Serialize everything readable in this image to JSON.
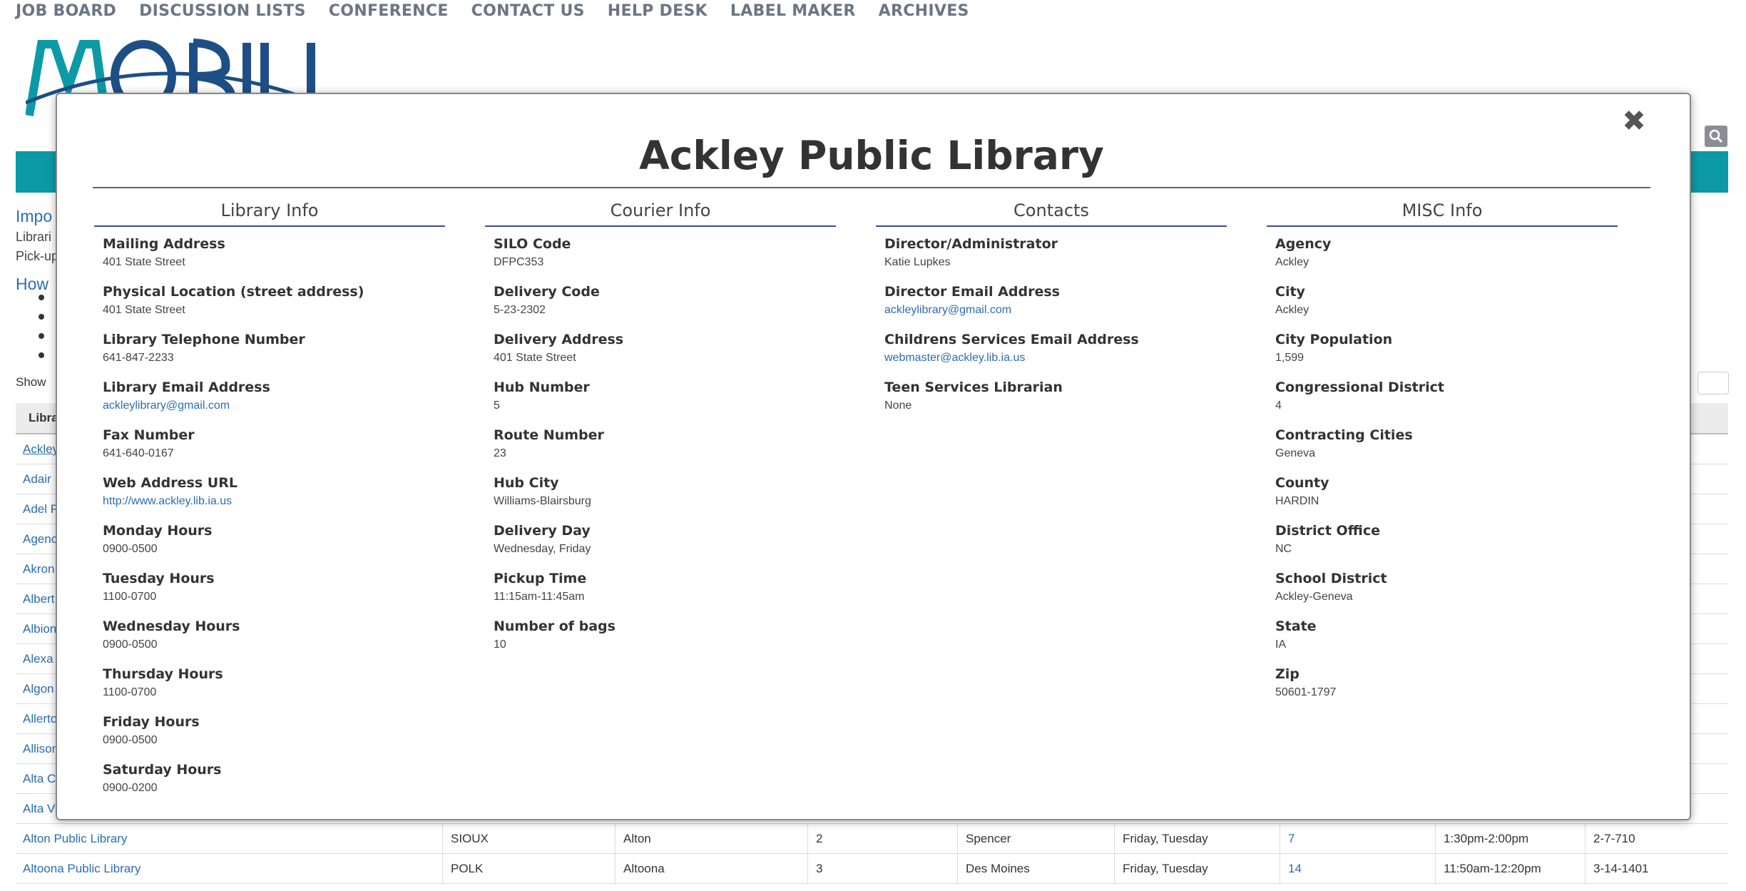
{
  "topnav": [
    "JOB BOARD",
    "DISCUSSION LISTS",
    "CONFERENCE",
    "CONTACT US",
    "HELP DESK",
    "LABEL MAKER",
    "ARCHIVES"
  ],
  "background": {
    "snippets": {
      "impo": "Impo",
      "librari": "Librari",
      "pickup": "Pick-up",
      "how": "How",
      "show": "Show",
      "table_header": "Libra"
    },
    "rows": [
      {
        "name": "Ackley"
      },
      {
        "name": "Adair"
      },
      {
        "name": "Adel P"
      },
      {
        "name": "Agenc"
      },
      {
        "name": "Akron"
      },
      {
        "name": "Albert"
      },
      {
        "name": "Albion"
      },
      {
        "name": "Alexa"
      },
      {
        "name": "Algon"
      },
      {
        "name": "Allerto"
      },
      {
        "name": "Allison"
      },
      {
        "name": "Alta C"
      },
      {
        "name": "Alta V"
      },
      {
        "name": "Alton Public Library",
        "county": "SIOUX",
        "city": "Alton",
        "district": "2",
        "hub": "Spencer",
        "days": "Friday, Tuesday",
        "route": "7",
        "time": "1:30pm-2:00pm",
        "code": "2-7-710"
      },
      {
        "name": "Altoona Public Library",
        "county": "POLK",
        "city": "Altoona",
        "district": "3",
        "hub": "Des Moines",
        "days": "Friday, Tuesday",
        "route": "14",
        "time": "11:50am-12:20pm",
        "code": "3-14-1401"
      }
    ]
  },
  "modal": {
    "close_glyph": "✖",
    "title": "Ackley Public Library",
    "columns": [
      {
        "heading": "Library Info",
        "fields": [
          {
            "label": "Mailing Address",
            "value": "401 State Street"
          },
          {
            "label": "Physical Location (street address)",
            "value": "401 State Street"
          },
          {
            "label": "Library Telephone Number",
            "value": "641-847-2233"
          },
          {
            "label": "Library Email Address",
            "value": "ackleylibrary@gmail.com",
            "link": true
          },
          {
            "label": "Fax Number",
            "value": "641-640-0167"
          },
          {
            "label": "Web Address URL",
            "value": "http://www.ackley.lib.ia.us",
            "link": true
          },
          {
            "label": "Monday Hours",
            "value": "0900-0500"
          },
          {
            "label": "Tuesday Hours",
            "value": "1100-0700"
          },
          {
            "label": "Wednesday Hours",
            "value": "0900-0500"
          },
          {
            "label": "Thursday Hours",
            "value": "1100-0700"
          },
          {
            "label": "Friday Hours",
            "value": "0900-0500"
          },
          {
            "label": "Saturday Hours",
            "value": "0900-0200"
          }
        ]
      },
      {
        "heading": "Courier Info",
        "fields": [
          {
            "label": "SILO Code",
            "value": "DFPC353"
          },
          {
            "label": "Delivery Code",
            "value": "5-23-2302"
          },
          {
            "label": "Delivery Address",
            "value": "401 State Street"
          },
          {
            "label": "Hub Number",
            "value": "5"
          },
          {
            "label": "Route Number",
            "value": "23"
          },
          {
            "label": "Hub City",
            "value": "Williams-Blairsburg"
          },
          {
            "label": "Delivery Day",
            "value": "Wednesday, Friday"
          },
          {
            "label": "Pickup Time",
            "value": "11:15am-11:45am"
          },
          {
            "label": "Number of bags",
            "value": "10"
          }
        ]
      },
      {
        "heading": "Contacts",
        "fields": [
          {
            "label": "Director/Administrator",
            "value": "Katie Lupkes"
          },
          {
            "label": "Director Email Address",
            "value": "ackleylibrary@gmail.com",
            "link": true
          },
          {
            "label": "Childrens Services Email Address",
            "value": "webmaster@ackley.lib.ia.us",
            "link": true
          },
          {
            "label": "Teen Services Librarian",
            "value": "None"
          }
        ]
      },
      {
        "heading": "MISC Info",
        "fields": [
          {
            "label": "Agency",
            "value": "Ackley"
          },
          {
            "label": "City",
            "value": "Ackley"
          },
          {
            "label": "City Population",
            "value": "1,599"
          },
          {
            "label": "Congressional District",
            "value": "4"
          },
          {
            "label": "Contracting Cities",
            "value": "Geneva"
          },
          {
            "label": "County",
            "value": "HARDIN"
          },
          {
            "label": "District Office",
            "value": "NC"
          },
          {
            "label": "School District",
            "value": "Ackley-Geneva"
          },
          {
            "label": "State",
            "value": "IA"
          },
          {
            "label": "Zip",
            "value": "50601-1797"
          }
        ]
      }
    ]
  },
  "colors": {
    "accent_teal": "#0c9aa6",
    "link_blue": "#2a6db3",
    "column_rule": "#3b4a9c",
    "nav_gray": "#6b7585"
  },
  "icons": {
    "search": "search-icon",
    "close": "close-icon",
    "logo": "mobius-logo"
  }
}
